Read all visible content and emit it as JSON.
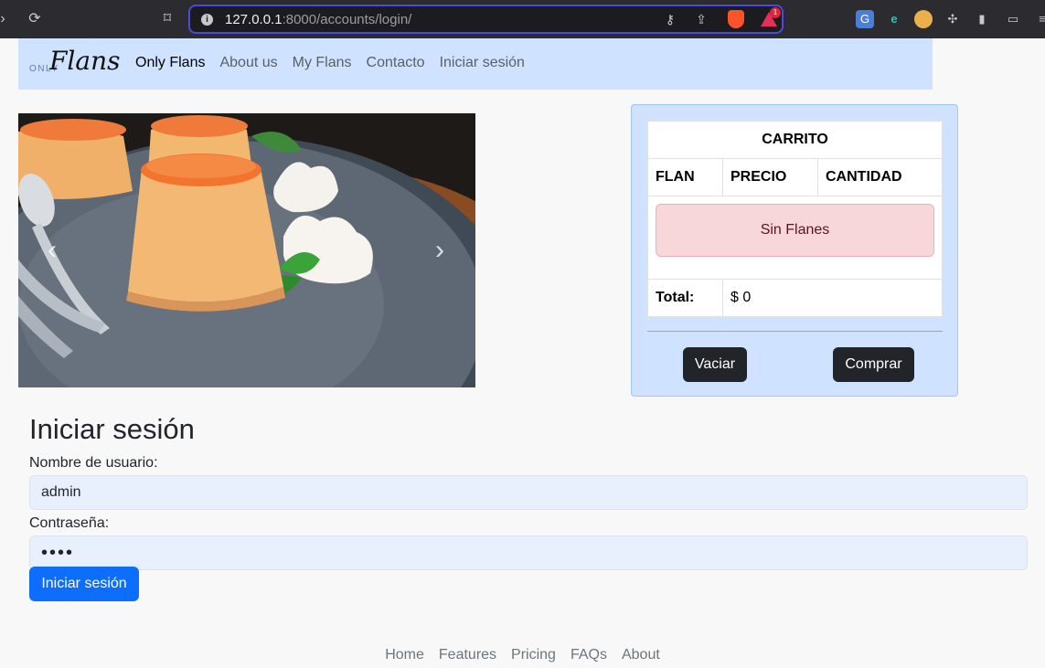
{
  "browser": {
    "url_host": "127.0.0.1",
    "url_rest": ":8000/accounts/login/",
    "rewards_count": "1"
  },
  "site": {
    "logo_small": "ONLY",
    "logo_script": "Flans",
    "nav": [
      {
        "label": "Only Flans"
      },
      {
        "label": "About us"
      },
      {
        "label": "My Flans"
      },
      {
        "label": "Contacto"
      },
      {
        "label": "Iniciar sesión"
      }
    ]
  },
  "carousel": {
    "prev_glyph": "‹",
    "next_glyph": "›"
  },
  "cart": {
    "title": "CARRITO",
    "columns": [
      "FLAN",
      "PRECIO",
      "CANTIDAD"
    ],
    "empty_message": "Sin Flanes",
    "total_label": "Total:",
    "total_value": "$ 0",
    "clear_button": "Vaciar",
    "buy_button": "Comprar"
  },
  "login": {
    "heading": "Iniciar sesión",
    "username_label": "Nombre de usuario:",
    "username_value": "admin",
    "password_label": "Contraseña:",
    "password_value": "••••",
    "submit_button": "Iniciar sesión"
  },
  "footer": {
    "links": [
      {
        "label": "Home"
      },
      {
        "label": "Features"
      },
      {
        "label": "Pricing"
      },
      {
        "label": "FAQs"
      },
      {
        "label": "About"
      }
    ]
  },
  "colors": {
    "nav_bg": "#cfe2ff",
    "primary": "#0d6efd",
    "dark_button": "#212529",
    "alert_bg": "#f8d7da"
  }
}
